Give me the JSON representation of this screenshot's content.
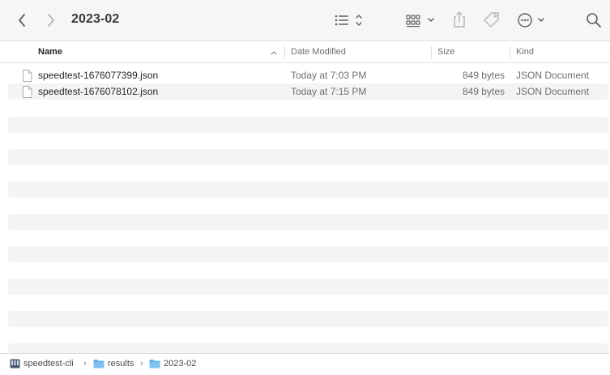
{
  "window": {
    "title": "2023-02"
  },
  "toolbar": {
    "back_icon": "chevron-left-icon",
    "forward_icon": "chevron-right-icon",
    "view_icon": "list-view-icon",
    "group_icon": "grid-group-icon",
    "share_icon": "share-icon",
    "tag_icon": "tag-icon",
    "more_icon": "ellipsis-circle-icon",
    "search_icon": "search-icon"
  },
  "columns": {
    "name": "Name",
    "date": "Date Modified",
    "size": "Size",
    "kind": "Kind",
    "sort": "ascending"
  },
  "files": [
    {
      "name": "speedtest-1676077399.json",
      "date": "Today at 7:03 PM",
      "size": "849 bytes",
      "kind": "JSON Document"
    },
    {
      "name": "speedtest-1676078102.json",
      "date": "Today at 7:15 PM",
      "size": "849 bytes",
      "kind": "JSON Document"
    }
  ],
  "pathbar": {
    "items": [
      {
        "label": "speedtest-cli",
        "icon": "disk-icon"
      },
      {
        "label": "results",
        "icon": "folder-icon"
      },
      {
        "label": "2023-02",
        "icon": "folder-icon"
      }
    ],
    "separator": "›"
  },
  "colors": {
    "toolbar_bg": "#f6f6f6",
    "alt_row": "#f4f4f4",
    "folder_blue": "#5ab0e8"
  }
}
